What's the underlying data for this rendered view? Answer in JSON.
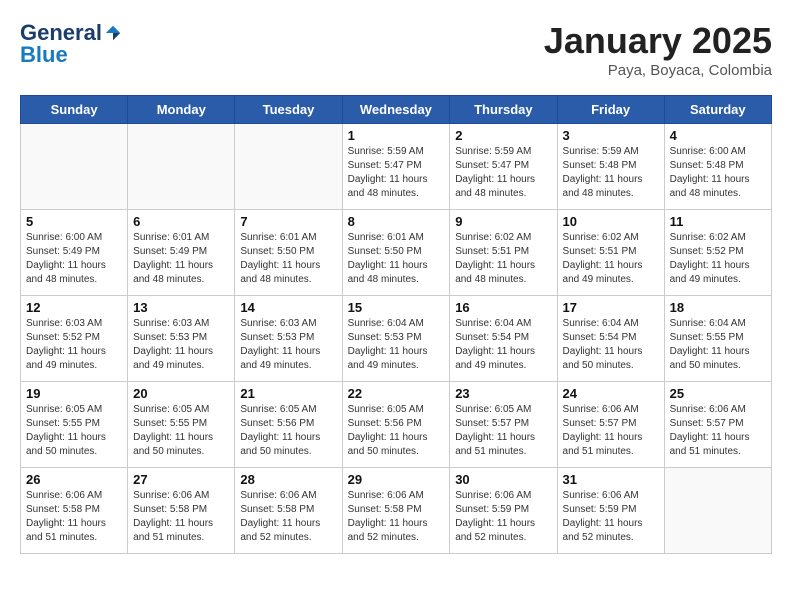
{
  "header": {
    "logo_general": "General",
    "logo_blue": "Blue",
    "month_title": "January 2025",
    "location": "Paya, Boyaca, Colombia"
  },
  "days_of_week": [
    "Sunday",
    "Monday",
    "Tuesday",
    "Wednesday",
    "Thursday",
    "Friday",
    "Saturday"
  ],
  "weeks": [
    [
      {
        "day": "",
        "sunrise": "",
        "sunset": "",
        "daylight": ""
      },
      {
        "day": "",
        "sunrise": "",
        "sunset": "",
        "daylight": ""
      },
      {
        "day": "",
        "sunrise": "",
        "sunset": "",
        "daylight": ""
      },
      {
        "day": "1",
        "sunrise": "Sunrise: 5:59 AM",
        "sunset": "Sunset: 5:47 PM",
        "daylight": "Daylight: 11 hours and 48 minutes."
      },
      {
        "day": "2",
        "sunrise": "Sunrise: 5:59 AM",
        "sunset": "Sunset: 5:47 PM",
        "daylight": "Daylight: 11 hours and 48 minutes."
      },
      {
        "day": "3",
        "sunrise": "Sunrise: 5:59 AM",
        "sunset": "Sunset: 5:48 PM",
        "daylight": "Daylight: 11 hours and 48 minutes."
      },
      {
        "day": "4",
        "sunrise": "Sunrise: 6:00 AM",
        "sunset": "Sunset: 5:48 PM",
        "daylight": "Daylight: 11 hours and 48 minutes."
      }
    ],
    [
      {
        "day": "5",
        "sunrise": "Sunrise: 6:00 AM",
        "sunset": "Sunset: 5:49 PM",
        "daylight": "Daylight: 11 hours and 48 minutes."
      },
      {
        "day": "6",
        "sunrise": "Sunrise: 6:01 AM",
        "sunset": "Sunset: 5:49 PM",
        "daylight": "Daylight: 11 hours and 48 minutes."
      },
      {
        "day": "7",
        "sunrise": "Sunrise: 6:01 AM",
        "sunset": "Sunset: 5:50 PM",
        "daylight": "Daylight: 11 hours and 48 minutes."
      },
      {
        "day": "8",
        "sunrise": "Sunrise: 6:01 AM",
        "sunset": "Sunset: 5:50 PM",
        "daylight": "Daylight: 11 hours and 48 minutes."
      },
      {
        "day": "9",
        "sunrise": "Sunrise: 6:02 AM",
        "sunset": "Sunset: 5:51 PM",
        "daylight": "Daylight: 11 hours and 48 minutes."
      },
      {
        "day": "10",
        "sunrise": "Sunrise: 6:02 AM",
        "sunset": "Sunset: 5:51 PM",
        "daylight": "Daylight: 11 hours and 49 minutes."
      },
      {
        "day": "11",
        "sunrise": "Sunrise: 6:02 AM",
        "sunset": "Sunset: 5:52 PM",
        "daylight": "Daylight: 11 hours and 49 minutes."
      }
    ],
    [
      {
        "day": "12",
        "sunrise": "Sunrise: 6:03 AM",
        "sunset": "Sunset: 5:52 PM",
        "daylight": "Daylight: 11 hours and 49 minutes."
      },
      {
        "day": "13",
        "sunrise": "Sunrise: 6:03 AM",
        "sunset": "Sunset: 5:53 PM",
        "daylight": "Daylight: 11 hours and 49 minutes."
      },
      {
        "day": "14",
        "sunrise": "Sunrise: 6:03 AM",
        "sunset": "Sunset: 5:53 PM",
        "daylight": "Daylight: 11 hours and 49 minutes."
      },
      {
        "day": "15",
        "sunrise": "Sunrise: 6:04 AM",
        "sunset": "Sunset: 5:53 PM",
        "daylight": "Daylight: 11 hours and 49 minutes."
      },
      {
        "day": "16",
        "sunrise": "Sunrise: 6:04 AM",
        "sunset": "Sunset: 5:54 PM",
        "daylight": "Daylight: 11 hours and 49 minutes."
      },
      {
        "day": "17",
        "sunrise": "Sunrise: 6:04 AM",
        "sunset": "Sunset: 5:54 PM",
        "daylight": "Daylight: 11 hours and 50 minutes."
      },
      {
        "day": "18",
        "sunrise": "Sunrise: 6:04 AM",
        "sunset": "Sunset: 5:55 PM",
        "daylight": "Daylight: 11 hours and 50 minutes."
      }
    ],
    [
      {
        "day": "19",
        "sunrise": "Sunrise: 6:05 AM",
        "sunset": "Sunset: 5:55 PM",
        "daylight": "Daylight: 11 hours and 50 minutes."
      },
      {
        "day": "20",
        "sunrise": "Sunrise: 6:05 AM",
        "sunset": "Sunset: 5:55 PM",
        "daylight": "Daylight: 11 hours and 50 minutes."
      },
      {
        "day": "21",
        "sunrise": "Sunrise: 6:05 AM",
        "sunset": "Sunset: 5:56 PM",
        "daylight": "Daylight: 11 hours and 50 minutes."
      },
      {
        "day": "22",
        "sunrise": "Sunrise: 6:05 AM",
        "sunset": "Sunset: 5:56 PM",
        "daylight": "Daylight: 11 hours and 50 minutes."
      },
      {
        "day": "23",
        "sunrise": "Sunrise: 6:05 AM",
        "sunset": "Sunset: 5:57 PM",
        "daylight": "Daylight: 11 hours and 51 minutes."
      },
      {
        "day": "24",
        "sunrise": "Sunrise: 6:06 AM",
        "sunset": "Sunset: 5:57 PM",
        "daylight": "Daylight: 11 hours and 51 minutes."
      },
      {
        "day": "25",
        "sunrise": "Sunrise: 6:06 AM",
        "sunset": "Sunset: 5:57 PM",
        "daylight": "Daylight: 11 hours and 51 minutes."
      }
    ],
    [
      {
        "day": "26",
        "sunrise": "Sunrise: 6:06 AM",
        "sunset": "Sunset: 5:58 PM",
        "daylight": "Daylight: 11 hours and 51 minutes."
      },
      {
        "day": "27",
        "sunrise": "Sunrise: 6:06 AM",
        "sunset": "Sunset: 5:58 PM",
        "daylight": "Daylight: 11 hours and 51 minutes."
      },
      {
        "day": "28",
        "sunrise": "Sunrise: 6:06 AM",
        "sunset": "Sunset: 5:58 PM",
        "daylight": "Daylight: 11 hours and 52 minutes."
      },
      {
        "day": "29",
        "sunrise": "Sunrise: 6:06 AM",
        "sunset": "Sunset: 5:58 PM",
        "daylight": "Daylight: 11 hours and 52 minutes."
      },
      {
        "day": "30",
        "sunrise": "Sunrise: 6:06 AM",
        "sunset": "Sunset: 5:59 PM",
        "daylight": "Daylight: 11 hours and 52 minutes."
      },
      {
        "day": "31",
        "sunrise": "Sunrise: 6:06 AM",
        "sunset": "Sunset: 5:59 PM",
        "daylight": "Daylight: 11 hours and 52 minutes."
      },
      {
        "day": "",
        "sunrise": "",
        "sunset": "",
        "daylight": ""
      }
    ]
  ]
}
